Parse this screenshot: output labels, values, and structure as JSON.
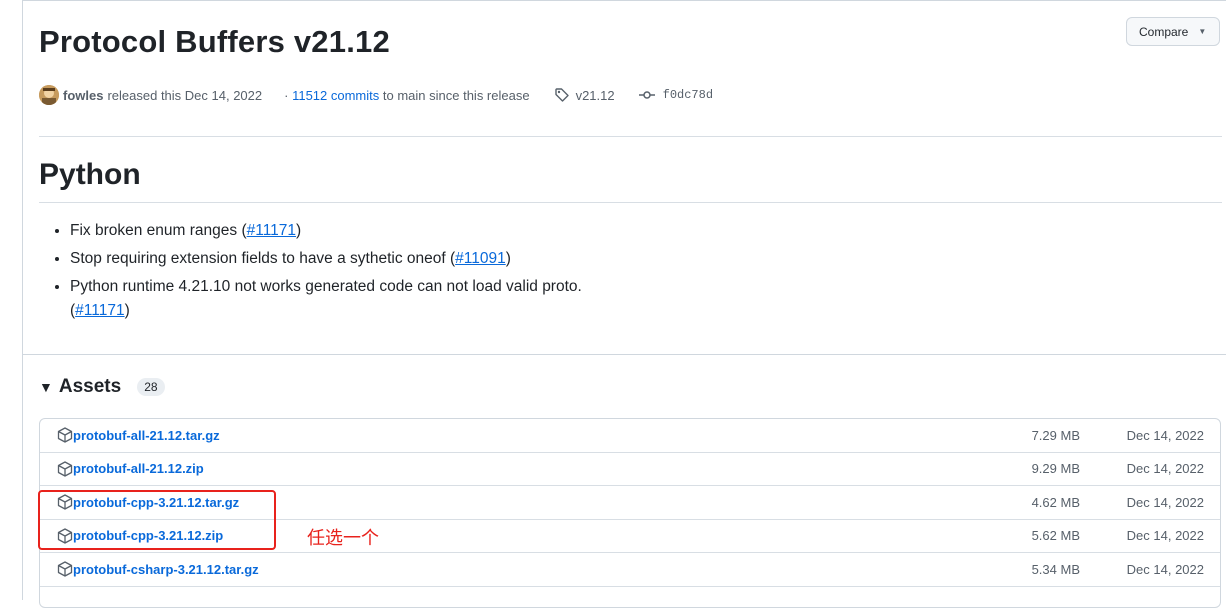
{
  "release": {
    "title": "Protocol Buffers v21.12",
    "author": "fowles",
    "released_text": "released this Dec 14, 2022",
    "commits_link": "11512 commits",
    "commits_suffix": "to main since this release",
    "tag": "v21.12",
    "commit_sha": "f0dc78d"
  },
  "compare_button": {
    "label": "Compare"
  },
  "notes": {
    "heading": "Python",
    "items": [
      {
        "text": "Fix broken enum ranges (",
        "link": "#11171",
        "suffix": ")"
      },
      {
        "text": "Stop requiring extension fields to have a sythetic oneof (",
        "link": "#11091",
        "suffix": ")"
      },
      {
        "text": "Python runtime 4.21.10 not works generated code can not load valid proto.",
        "text2": "(",
        "link": "#11171",
        "suffix": ")"
      }
    ]
  },
  "assets": {
    "title": "Assets",
    "count": "28",
    "rows": [
      {
        "name": "protobuf-all-21.12.tar.gz",
        "size": "7.29 MB",
        "date": "Dec 14, 2022"
      },
      {
        "name": "protobuf-all-21.12.zip",
        "size": "9.29 MB",
        "date": "Dec 14, 2022"
      },
      {
        "name": "protobuf-cpp-3.21.12.tar.gz",
        "size": "4.62 MB",
        "date": "Dec 14, 2022"
      },
      {
        "name": "protobuf-cpp-3.21.12.zip",
        "size": "5.62 MB",
        "date": "Dec 14, 2022"
      },
      {
        "name": "protobuf-csharp-3.21.12.tar.gz",
        "size": "5.34 MB",
        "date": "Dec 14, 2022"
      }
    ]
  },
  "annotation": {
    "text": "任选一个",
    "color": "#e8221c"
  },
  "colors": {
    "link": "#0969da",
    "muted": "#57606a",
    "border": "#d0d7de"
  }
}
